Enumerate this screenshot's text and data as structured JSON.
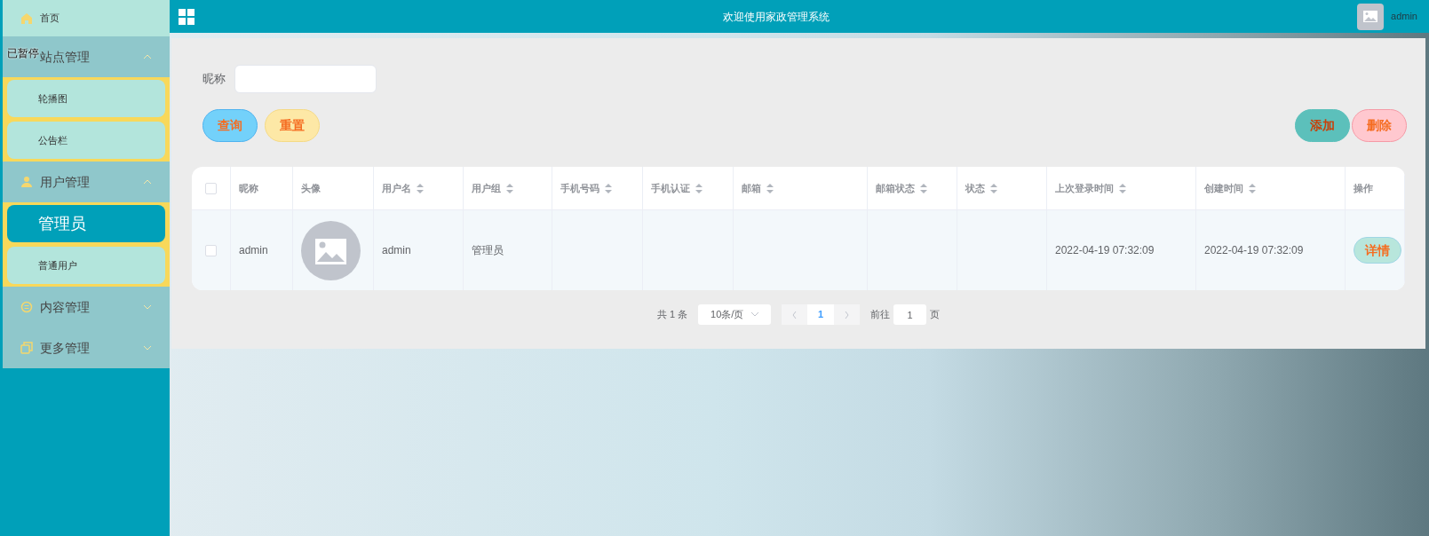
{
  "overlay_label": "已暂停",
  "sidebar": {
    "items": [
      {
        "label": "首页",
        "kind": "link",
        "selected": false
      },
      {
        "label": "站点管理",
        "kind": "group",
        "expanded": true,
        "children": [
          {
            "label": "轮播图",
            "selected": false
          },
          {
            "label": "公告栏",
            "selected": false
          }
        ]
      },
      {
        "label": "用户管理",
        "kind": "group",
        "expanded": true,
        "children": [
          {
            "label": "管理员",
            "selected": true
          },
          {
            "label": "普通用户",
            "selected": false
          }
        ]
      },
      {
        "label": "内容管理",
        "kind": "group",
        "expanded": false
      },
      {
        "label": "更多管理",
        "kind": "group",
        "expanded": false
      }
    ]
  },
  "header": {
    "title": "欢迎使用家政管理系统",
    "user": "admin"
  },
  "search": {
    "label": "昵称"
  },
  "buttons": [
    {
      "label": "查询",
      "kind": "query"
    },
    {
      "label": "重置",
      "kind": "reset"
    },
    {
      "label": "添加",
      "kind": "add"
    },
    {
      "label": "删除",
      "kind": "delete"
    }
  ],
  "table": {
    "select_all": {
      "checked": false
    },
    "columns": [
      {
        "label": "昵称",
        "sortable": false
      },
      {
        "label": "头像",
        "sortable": false
      },
      {
        "label": "用户名",
        "sortable": true
      },
      {
        "label": "用户组",
        "sortable": true
      },
      {
        "label": "手机号码",
        "sortable": true
      },
      {
        "label": "手机认证",
        "sortable": true
      },
      {
        "label": "邮箱",
        "sortable": true
      },
      {
        "label": "邮箱状态",
        "sortable": true
      },
      {
        "label": "状态",
        "sortable": true
      },
      {
        "label": "上次登录时间",
        "sortable": true
      },
      {
        "label": "创建时间",
        "sortable": true
      },
      {
        "label": "操作",
        "sortable": false
      }
    ],
    "rows": [
      {
        "checked": false,
        "cells": [
          "admin",
          {
            "kind": "avatar"
          },
          "admin",
          "管理员",
          "",
          "",
          "",
          "",
          "",
          "2022-04-19 07:32:09",
          "2022-04-19 07:32:09",
          {
            "kind": "action",
            "label": "详情"
          }
        ]
      }
    ]
  },
  "pagination": {
    "total": "共 1 条",
    "page_size": "10条/页",
    "pages": [
      {
        "label": "1",
        "selected": true
      }
    ],
    "goto_label": "前往",
    "goto_value": "1",
    "page_unit": "页"
  }
}
